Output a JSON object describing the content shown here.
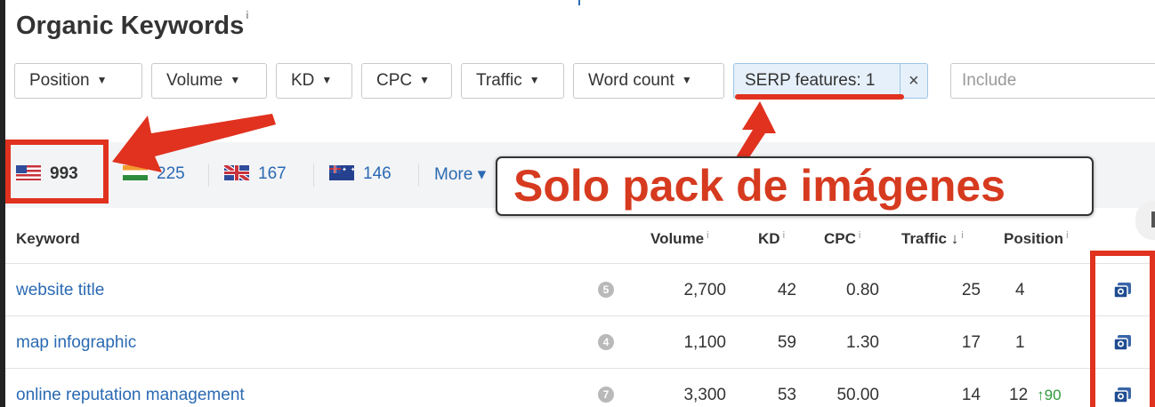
{
  "page": {
    "title": "Organic Keywords",
    "title_info": "i"
  },
  "filters": {
    "items": [
      "Position",
      "Volume",
      "KD",
      "CPC",
      "Traffic",
      "Word count"
    ],
    "serp_label": "SERP features: 1",
    "serp_clear": "×",
    "include_placeholder": "Include"
  },
  "countries": {
    "items": [
      {
        "flag": "us-flag-icon",
        "count": "993"
      },
      {
        "flag": "in-flag-icon",
        "count": "225"
      },
      {
        "flag": "gb-flag-icon",
        "count": "167"
      },
      {
        "flag": "au-flag-icon",
        "count": "146"
      }
    ],
    "more_label": "More ▾"
  },
  "table": {
    "headers": {
      "keyword": "Keyword",
      "volume": "Volume",
      "kd": "KD",
      "cpc": "CPC",
      "traffic": "Traffic ↓",
      "position": "Position",
      "info": "i"
    },
    "rows": [
      {
        "keyword": "website title",
        "serp": "5",
        "volume": "2,700",
        "kd": "42",
        "cpc": "0.80",
        "traffic": "25",
        "position": "4",
        "change": ""
      },
      {
        "keyword": "map infographic",
        "serp": "4",
        "volume": "1,100",
        "kd": "59",
        "cpc": "1.30",
        "traffic": "17",
        "position": "1",
        "change": ""
      },
      {
        "keyword": "online reputation management",
        "serp": "7",
        "volume": "3,300",
        "kd": "53",
        "cpc": "50.00",
        "traffic": "14",
        "position": "12",
        "change": "↑90"
      }
    ]
  },
  "annotation": {
    "text": "Solo pack de imágenes",
    "color": "#d63a1f"
  },
  "colors": {
    "link": "#2b6ab3",
    "serp_active_bg": "#e6f0fa",
    "highlight": "#e0321f",
    "up": "#2f9a3c"
  }
}
